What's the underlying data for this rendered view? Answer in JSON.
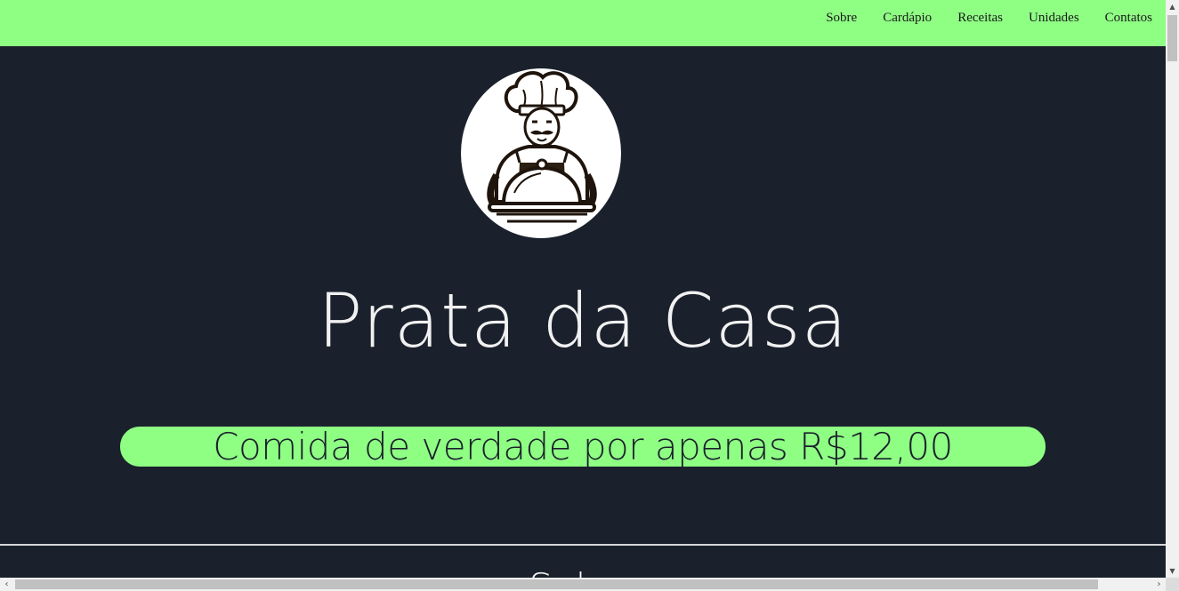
{
  "nav": {
    "items": [
      {
        "label": "Sobre"
      },
      {
        "label": "Cardápio"
      },
      {
        "label": "Receitas"
      },
      {
        "label": "Unidades"
      },
      {
        "label": "Contatos"
      }
    ]
  },
  "hero": {
    "logo_icon": "chef-holding-cloche-icon",
    "title": "Prata da Casa",
    "tagline": "Comida de verdade por apenas R$12,00"
  },
  "next_section": {
    "heading_partial": "Sobre"
  },
  "scrollbars": {
    "up_icon": "arrow-up-icon",
    "down_icon": "arrow-down-icon",
    "left_icon": "arrow-left-icon",
    "right_icon": "arrow-right-icon",
    "up_glyph": "▲",
    "down_glyph": "▼",
    "left_glyph": "‹",
    "right_glyph": "›"
  },
  "colors": {
    "accent_green": "#8fff84",
    "background_dark": "#1b212c",
    "text_light": "#f1f1f1"
  }
}
